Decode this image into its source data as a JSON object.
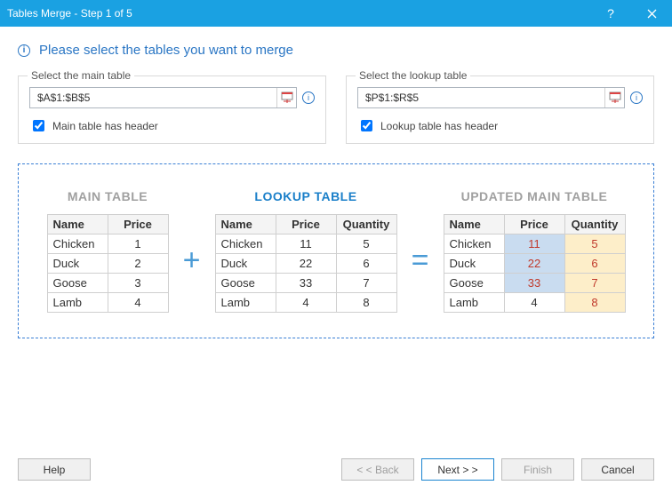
{
  "window": {
    "title": "Tables Merge - Step 1 of 5"
  },
  "instruction": "Please select the tables you want to merge",
  "main_select": {
    "legend": "Select the main table",
    "range": "$A$1:$B$5",
    "checkbox_label": "Main table has header",
    "checked": true
  },
  "lookup_select": {
    "legend": "Select the lookup table",
    "range": "$P$1:$R$5",
    "checkbox_label": "Lookup table has header",
    "checked": true
  },
  "tables": {
    "main": {
      "title": "MAIN TABLE",
      "headers": [
        "Name",
        "Price"
      ],
      "rows": [
        [
          "Chicken",
          "1"
        ],
        [
          "Duck",
          "2"
        ],
        [
          "Goose",
          "3"
        ],
        [
          "Lamb",
          "4"
        ]
      ]
    },
    "lookup": {
      "title": "LOOKUP TABLE",
      "headers": [
        "Name",
        "Price",
        "Quantity"
      ],
      "rows": [
        [
          "Chicken",
          "11",
          "5"
        ],
        [
          "Duck",
          "22",
          "6"
        ],
        [
          "Goose",
          "33",
          "7"
        ],
        [
          "Lamb",
          "4",
          "8"
        ]
      ]
    },
    "updated": {
      "title": "UPDATED MAIN TABLE",
      "headers": [
        "Name",
        "Price",
        "Quantity"
      ],
      "rows": [
        {
          "cells": [
            "Chicken",
            "11",
            "5"
          ],
          "priceChanged": true
        },
        {
          "cells": [
            "Duck",
            "22",
            "6"
          ],
          "priceChanged": true
        },
        {
          "cells": [
            "Goose",
            "33",
            "7"
          ],
          "priceChanged": true
        },
        {
          "cells": [
            "Lamb",
            "4",
            "8"
          ],
          "priceChanged": false
        }
      ]
    }
  },
  "buttons": {
    "help": "Help",
    "back": "< < Back",
    "next": "Next > >",
    "finish": "Finish",
    "cancel": "Cancel"
  }
}
